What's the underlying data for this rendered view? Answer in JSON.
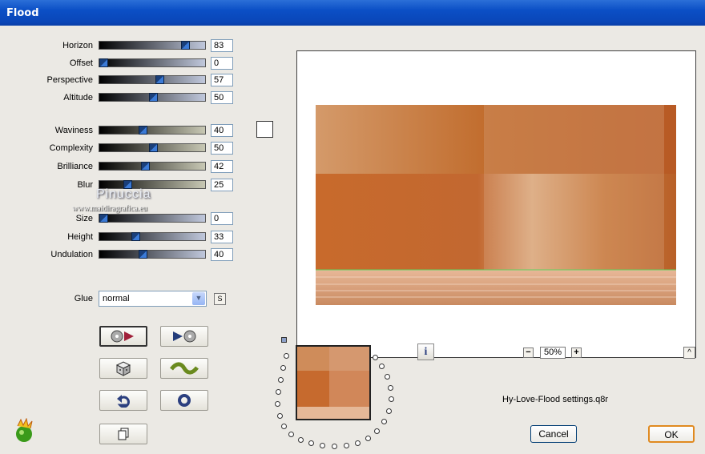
{
  "window": {
    "title": "Flood"
  },
  "sliders_group1": [
    {
      "label": "Horizon",
      "value": "83"
    },
    {
      "label": "Offset",
      "value": "0"
    },
    {
      "label": "Perspective",
      "value": "57"
    },
    {
      "label": "Altitude",
      "value": "50"
    }
  ],
  "sliders_group2": [
    {
      "label": "Waviness",
      "value": "40"
    },
    {
      "label": "Complexity",
      "value": "50"
    },
    {
      "label": "Brilliance",
      "value": "42"
    },
    {
      "label": "Blur",
      "value": "25"
    }
  ],
  "sliders_group3": [
    {
      "label": "Size",
      "value": "0"
    },
    {
      "label": "Height",
      "value": "33"
    },
    {
      "label": "Undulation",
      "value": "40"
    }
  ],
  "watermark": {
    "name": "Pinuccia",
    "url": "www.maidiragrafica.eu"
  },
  "glue": {
    "label": "Glue",
    "value": "normal",
    "s_label": "S"
  },
  "zoom": {
    "value": "50%",
    "minus": "−",
    "plus": "+"
  },
  "info_label": "i",
  "settings_file": "Hy-Love-Flood settings.q8r",
  "buttons": {
    "cancel": "Cancel",
    "ok": "OK",
    "collapse": "^"
  },
  "colors": {
    "title_bar": "#0a4fc6",
    "slider_dark": "#000000",
    "slider_light_blue": "#c0c8dc",
    "slider_light_khaki": "#c8c8b4",
    "flood_image_orange": "#c87a3c"
  }
}
